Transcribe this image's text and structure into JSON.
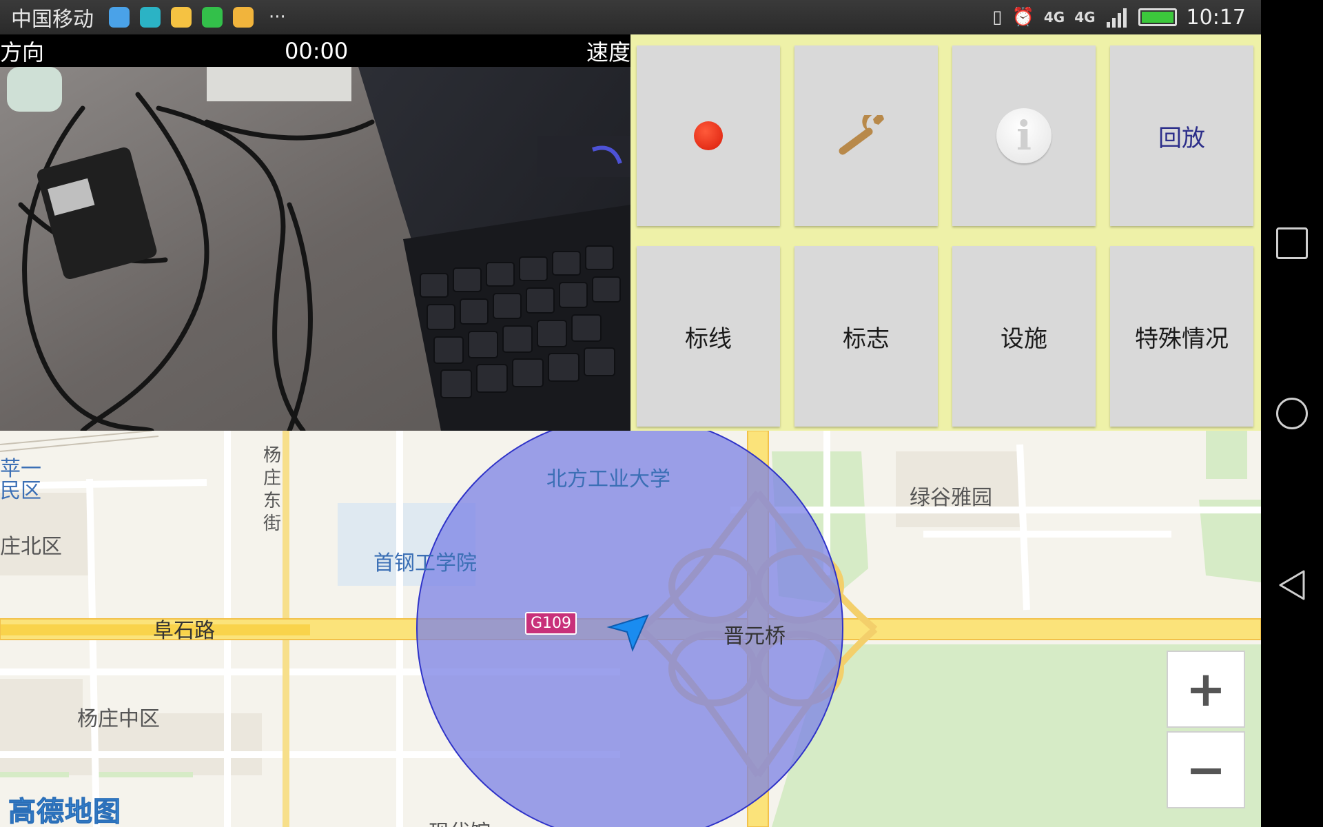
{
  "status_bar": {
    "carrier": "中国移动",
    "app_icons": [
      "qq-browser-icon",
      "android-icon",
      "weibo-icon",
      "wechat-icon",
      "shopping-bag-icon"
    ],
    "overflow": "···",
    "network_1": "4G",
    "network_2": "4G",
    "time": "10:17",
    "battery_level": 1.0
  },
  "camera": {
    "direction_label": "方向",
    "timer": "00:00",
    "speed_label": "速度"
  },
  "panel": {
    "tiles": [
      {
        "label": "",
        "icon": "record-dot-icon"
      },
      {
        "label": "",
        "icon": "wrench-icon"
      },
      {
        "label": "",
        "icon": "info-icon"
      },
      {
        "label": "回放"
      },
      {
        "label": "标线"
      },
      {
        "label": "标志"
      },
      {
        "label": "设施"
      },
      {
        "label": "特殊情况"
      }
    ],
    "colors": {
      "background": "#eef1a8",
      "tile": "#d9d9d9",
      "record": "#e0220e"
    }
  },
  "map": {
    "labels": {
      "univ": "北方工业大学",
      "college": "首钢工学院",
      "green_garden": "绿谷雅园",
      "road_fushi": "阜石路",
      "bridge": "晋元桥",
      "yangzhuang_north": "庄北区",
      "yangzhuang_mid": "杨庄中区",
      "pingyi_top": "苹一",
      "pingyi_bottom": "民区",
      "street_vertical": "杨庄东街",
      "bottom_partial": "现代馆",
      "road_badge": "G109"
    },
    "logo": "高德地图",
    "zoom_in": "+",
    "zoom_out": "−",
    "colors": {
      "accuracy_circle": "#7b82e6",
      "highway": "#fbe37a",
      "park": "#d6ebc6"
    }
  }
}
